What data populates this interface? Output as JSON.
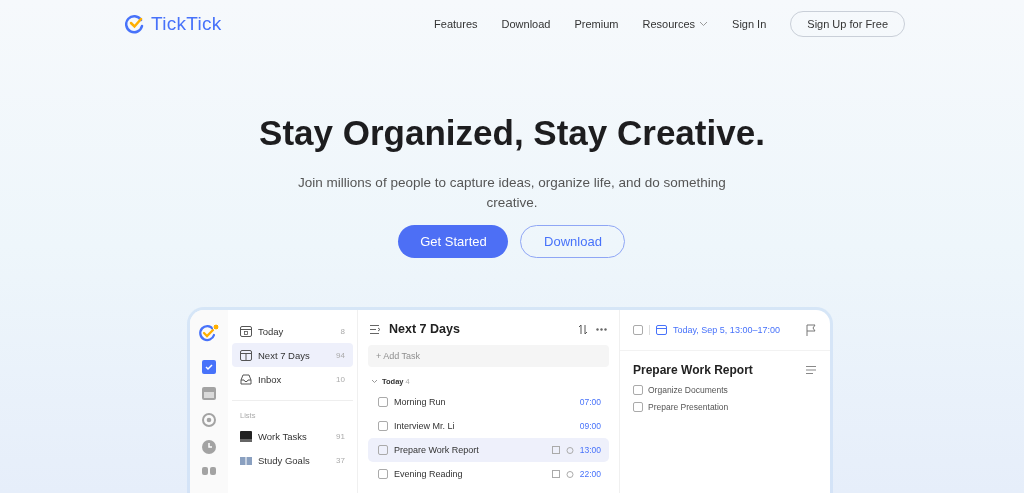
{
  "header": {
    "logo": "TickTick",
    "nav": [
      {
        "label": "Features",
        "dropdown": false
      },
      {
        "label": "Download",
        "dropdown": false
      },
      {
        "label": "Premium",
        "dropdown": false
      },
      {
        "label": "Resources",
        "dropdown": true
      },
      {
        "label": "Sign In",
        "dropdown": false
      }
    ],
    "signup": "Sign Up for Free"
  },
  "hero": {
    "title": "Stay Organized, Stay Creative.",
    "subtitle": "Join millions of people to capture ideas, organize life, and do something creative.",
    "primary": "Get Started",
    "secondary": "Download"
  },
  "app": {
    "rail": [
      {
        "kind": "tasks",
        "selected": true
      },
      {
        "kind": "calendar",
        "selected": false
      },
      {
        "kind": "focus",
        "selected": false
      },
      {
        "kind": "clock",
        "selected": false
      },
      {
        "kind": "more",
        "selected": false
      }
    ],
    "smart_lists": [
      {
        "kind": "today",
        "label": "Today",
        "count": "8",
        "selected": false
      },
      {
        "kind": "week",
        "label": "Next 7 Days",
        "count": "94",
        "selected": true
      },
      {
        "kind": "inbox",
        "label": "Inbox",
        "count": "10",
        "selected": false
      }
    ],
    "lists_heading": "Lists",
    "lists": [
      {
        "kind": "dark",
        "label": "Work Tasks",
        "count": "91"
      },
      {
        "kind": "book",
        "label": "Study Goals",
        "count": "37"
      }
    ],
    "task_panel": {
      "title": "Next 7 Days",
      "add_placeholder": "+ Add Task",
      "section": "Today",
      "section_count": "4",
      "expanded": true,
      "tasks": [
        {
          "title": "Morning Run",
          "time": "07:00",
          "checked": false,
          "selected": false,
          "icons": false
        },
        {
          "title": "Interview Mr. Li",
          "time": "09:00",
          "checked": false,
          "selected": false,
          "icons": false
        },
        {
          "title": "Prepare Work Report",
          "time": "13:00",
          "checked": false,
          "selected": true,
          "icons": true
        },
        {
          "title": "Evening Reading",
          "time": "22:00",
          "checked": false,
          "selected": false,
          "icons": true
        }
      ]
    },
    "detail": {
      "checked": false,
      "date": "Today, Sep 5, 13:00–17:00",
      "title": "Prepare Work Report",
      "subtasks": [
        {
          "title": "Organize Documents",
          "checked": false
        },
        {
          "title": "Prepare Presentation",
          "checked": false
        }
      ]
    }
  }
}
